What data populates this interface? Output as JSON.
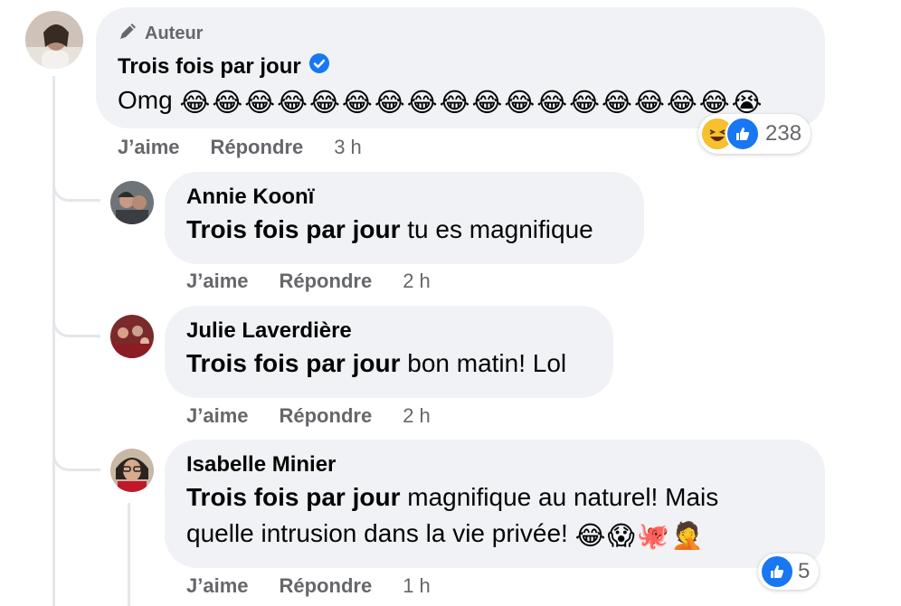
{
  "main_comment": {
    "author_badge": "Auteur",
    "author": "Trois fois par jour",
    "text": "Omg",
    "emojis": [
      "😂",
      "😂",
      "😂",
      "😂",
      "😂",
      "😂",
      "😂",
      "😂",
      "😂",
      "😂",
      "😂",
      "😂",
      "😂",
      "😂",
      "😂",
      "😂",
      "😂",
      "😭"
    ],
    "reaction_count": "238",
    "reaction_icons": [
      "laughing-reaction",
      "like-reaction"
    ],
    "actions": {
      "like": "J’aime",
      "reply": "Répondre",
      "time": "3 h"
    }
  },
  "replies": [
    {
      "author": "Annie Koonï",
      "mention": "Trois fois par jour",
      "text": " tu es magnifique",
      "actions": {
        "like": "J’aime",
        "reply": "Répondre",
        "time": "2 h"
      }
    },
    {
      "author": "Julie Laverdière",
      "mention": "Trois fois par jour",
      "text": " bon matin! Lol",
      "actions": {
        "like": "J’aime",
        "reply": "Répondre",
        "time": "2 h"
      }
    },
    {
      "author": "Isabelle Minier",
      "mention": "Trois fois par jour",
      "text_line1": " magnifique au naturel! Mais",
      "text_line2": "quelle intrusion dans la vie privée! ",
      "emojis": [
        "😂",
        "😱",
        "🐙",
        "🤦"
      ],
      "reaction_count": "5",
      "actions": {
        "like": "J’aime",
        "reply": "Répondre",
        "time": "1 h"
      }
    }
  ],
  "colors": {
    "bubble": "#f0f2f5",
    "verified": "#1877f2",
    "muted": "#65676b",
    "like_blue": "#1877f2"
  }
}
